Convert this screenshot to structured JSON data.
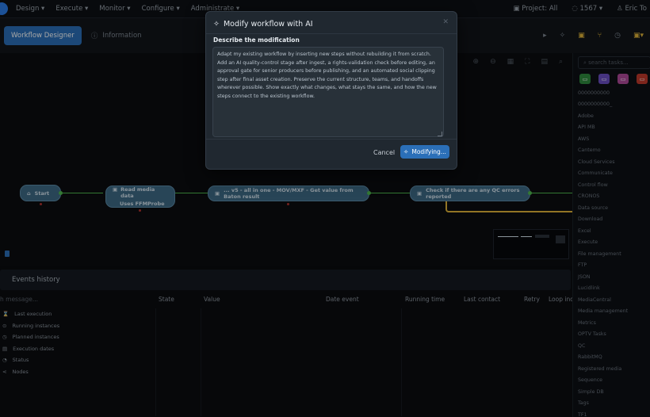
{
  "topnav": {
    "menu": [
      "Design ▾",
      "Execute ▾",
      "Monitor ▾",
      "Configure ▾",
      "Administrate ▾"
    ],
    "project": "Project: All",
    "notifications": "1567 ▾",
    "user": "Eric To"
  },
  "tabs": {
    "active": "Workflow Designer",
    "info": "Information"
  },
  "workflow": {
    "nodes": [
      {
        "label": "Start"
      },
      {
        "label": "Read media data",
        "sublabel": "Uses FFMProbe"
      },
      {
        "label": "... v5 - all in one - MOV/MXF - Get value from Baton result"
      },
      {
        "label": "Check if there are any QC errors reported"
      }
    ],
    "colors": {
      "node": "#3e6a86",
      "edge": "#4fb84f",
      "error": "#b3322f",
      "branch": "#e0b43a"
    }
  },
  "events": {
    "title": "Events history",
    "search_placeholder": "h message...",
    "columns": [
      "State",
      "Value",
      "Date event",
      "Running time",
      "Last contact",
      "Retry",
      "Loop inde"
    ],
    "sidebar": [
      {
        "icon": "hourglass-icon",
        "label": "Last execution"
      },
      {
        "icon": "play-circle-icon",
        "label": "Running instances"
      },
      {
        "icon": "clock-icon",
        "label": "Planned instances"
      },
      {
        "icon": "calendar-icon",
        "label": "Execution dates"
      },
      {
        "icon": "status-icon",
        "label": "Status"
      },
      {
        "icon": "share-nodes-icon",
        "label": "Nodes"
      }
    ]
  },
  "task_panel": {
    "search_placeholder": "search tasks...",
    "categories": [
      "0000000000",
      "0000000000_",
      "Adobe",
      "API MB",
      "AWS",
      "Cantemo",
      "Cloud Services",
      "Communicate",
      "Control flow",
      "CRONOS",
      "Data source",
      "Download",
      "Excel",
      "Execute",
      "File management",
      "FTP",
      "JSON",
      "Lucidlink",
      "MediaCentral",
      "Media management",
      "Metrics",
      "OPTV Tasks",
      "QC",
      "RabbitMQ",
      "Registered media",
      "Sequence",
      "Simple DB",
      "Tags",
      "TF1"
    ]
  },
  "modal": {
    "title": "Modify workflow with AI",
    "label": "Describe the modification",
    "text": "Adapt my existing workflow by inserting new steps without rebuilding it from scratch. Add an AI quality-control stage after ingest, a rights-validation check before editing, an approval gate for senior producers before publishing, and an automated social clipping step after final asset creation. Preserve the current structure, teams, and handoffs wherever possible. Show exactly what changes, what stays the same, and how the new steps connect to the existing workflow.",
    "cancel": "Cancel",
    "confirm": "Modifying..."
  }
}
